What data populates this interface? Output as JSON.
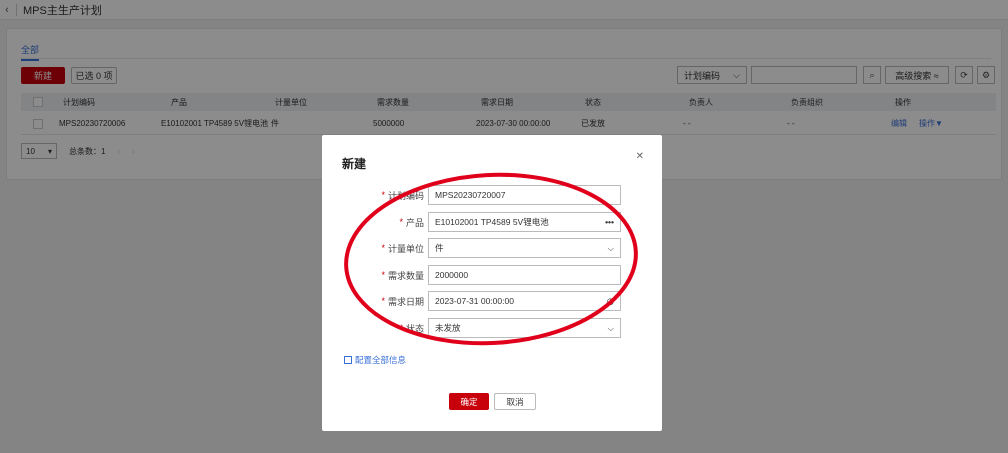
{
  "page": {
    "title": "MPS主生产计划",
    "back_icon": "chevron-left-icon"
  },
  "tabs": [
    {
      "label": "全部"
    }
  ],
  "toolbar": {
    "new_label": "新建",
    "selected_label": "已选 0 项",
    "plan_select_value": "计划编码",
    "search_placeholder": "",
    "advanced_search_label": "高级搜索 ≈"
  },
  "table": {
    "headers": [
      "计划编码",
      "产品",
      "计量单位",
      "需求数量",
      "需求日期",
      "状态",
      "负责人",
      "负责组织",
      "操作"
    ],
    "rows": [
      {
        "code": "MPS20230720006",
        "product": "E10102001 TP4589 5V锂电池",
        "unit": "件",
        "qty": "5000000",
        "date": "2023-07-30 00:00:00",
        "status": "已发放",
        "owner": "- -",
        "org": "- -",
        "edit": "编辑",
        "ops": "操作▼"
      }
    ]
  },
  "pager": {
    "page_size": "10",
    "total": "总条数：1"
  },
  "dialog": {
    "title": "新建",
    "fields": {
      "code": {
        "label": "计划编码",
        "value": "MPS20230720007"
      },
      "product": {
        "label": "产品",
        "value": "E10102001 TP4589 5V锂电池"
      },
      "unit": {
        "label": "计量单位",
        "value": "件"
      },
      "qty": {
        "label": "需求数量",
        "value": "2000000"
      },
      "date": {
        "label": "需求日期",
        "value": "2023-07-31 00:00:00"
      },
      "status": {
        "label": "状态",
        "value": "未发放"
      }
    },
    "config_link": "配置全部信息",
    "ok_label": "确定",
    "cancel_label": "取消"
  },
  "colors": {
    "brand": "#c7000b",
    "link": "#3a6fd8",
    "annotation": "#e0001b"
  }
}
